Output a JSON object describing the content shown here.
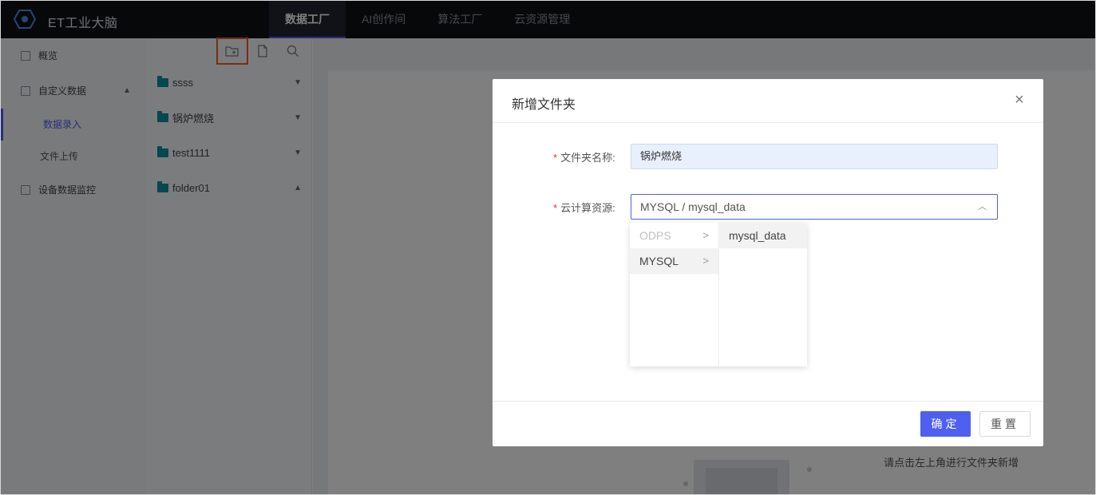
{
  "app": {
    "brand": "ET工业大脑"
  },
  "nav": {
    "items": [
      "数据工厂",
      "AI创作间",
      "算法工厂",
      "云资源管理"
    ],
    "active": 0
  },
  "sidebar": {
    "overview": "概览",
    "custom_data": "自定义数据",
    "data_entry": "数据录入",
    "file_upload": "文件上传",
    "device_monitor": "设备数据监控"
  },
  "folders": [
    {
      "name": "ssss",
      "expanded": false
    },
    {
      "name": "锅炉燃烧",
      "expanded": false
    },
    {
      "name": "test1111",
      "expanded": false
    },
    {
      "name": "folder01",
      "expanded": true
    }
  ],
  "toolbar_icons": [
    "new-folder-icon",
    "new-file-icon",
    "search-icon"
  ],
  "main": {
    "empty_hint": "请点击左上角进行文件夹新增"
  },
  "dialog": {
    "title": "新增文件夹",
    "close": "×",
    "required_mark": "*",
    "folder_name_label": "文件夹名称:",
    "folder_name_value": "锅炉燃烧",
    "resource_label": "云计算资源:",
    "resource_value": "MYSQL / mysql_data",
    "cascader": {
      "col1": [
        {
          "label": "ODPS",
          "disabled": true
        },
        {
          "label": "MYSQL",
          "disabled": false
        }
      ],
      "col2": [
        {
          "label": "mysql_data"
        }
      ]
    },
    "confirm": "确定",
    "reset": "重置"
  },
  "colors": {
    "primary": "#4f5ff0",
    "topbar": "#0e1014",
    "folder": "#0f8ea0",
    "highlight": "#f05a28"
  }
}
